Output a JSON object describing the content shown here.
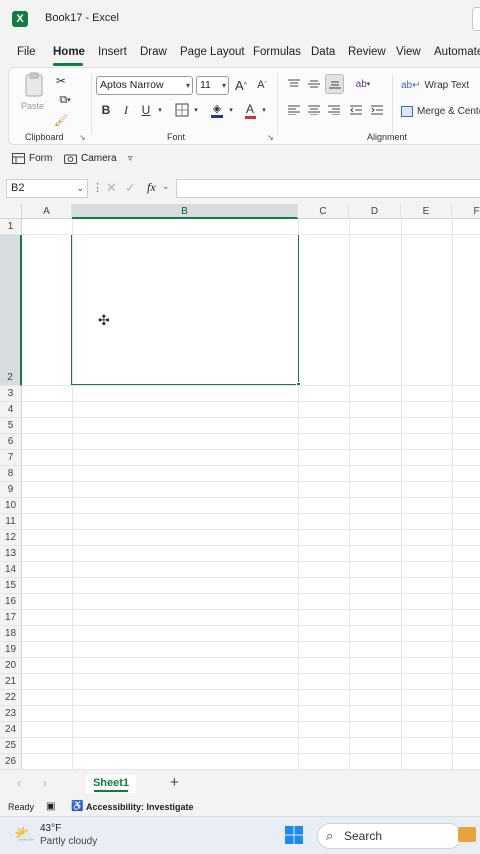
{
  "window": {
    "title": "Book17  -  Excel",
    "app_icon": "X"
  },
  "menu": {
    "items": [
      {
        "label": "File",
        "active": false
      },
      {
        "label": "Home",
        "active": true
      },
      {
        "label": "Insert",
        "active": false
      },
      {
        "label": "Draw",
        "active": false
      },
      {
        "label": "Page Layout",
        "active": false
      },
      {
        "label": "Formulas",
        "active": false
      },
      {
        "label": "Data",
        "active": false
      },
      {
        "label": "Review",
        "active": false
      },
      {
        "label": "View",
        "active": false
      },
      {
        "label": "Automate",
        "active": false
      }
    ]
  },
  "ribbon": {
    "clipboard": {
      "label": "Clipboard",
      "paste_label": "Paste"
    },
    "font": {
      "label": "Font",
      "font_name": "Aptos Narrow",
      "font_size": "11",
      "bold": "B",
      "italic": "I",
      "underline": "U",
      "grow": "A",
      "shrink": "A",
      "color_a": "A"
    },
    "alignment": {
      "label": "Alignment",
      "wrap_text": "Wrap Text",
      "merge_center": "Merge & Center"
    }
  },
  "quick_access": {
    "form": "Form",
    "camera": "Camera"
  },
  "formula_bar": {
    "name_box": "B2",
    "fx": "fx",
    "value": ""
  },
  "sheet": {
    "columns": [
      "A",
      "B",
      "C",
      "D",
      "E",
      "F"
    ],
    "selected_column": "B",
    "rows": [
      "1",
      "2",
      "3",
      "4",
      "5",
      "6",
      "7",
      "8",
      "9",
      "10",
      "11",
      "12",
      "13",
      "14",
      "15",
      "16",
      "17",
      "18",
      "19",
      "20",
      "21",
      "22",
      "23",
      "24",
      "25",
      "26"
    ],
    "selected_row": "2",
    "active_cell": "B2"
  },
  "sheet_tabs": {
    "tabs": [
      "Sheet1"
    ],
    "active": "Sheet1",
    "add": "+"
  },
  "status": {
    "ready": "Ready",
    "accessibility": "Accessibility: Investigate"
  },
  "taskbar": {
    "temperature": "43°F",
    "weather": "Partly cloudy",
    "search": "Search"
  },
  "colors": {
    "accent": "#107c41",
    "grid_line": "#e6e6e6",
    "header_bg": "#f3f3f3"
  }
}
